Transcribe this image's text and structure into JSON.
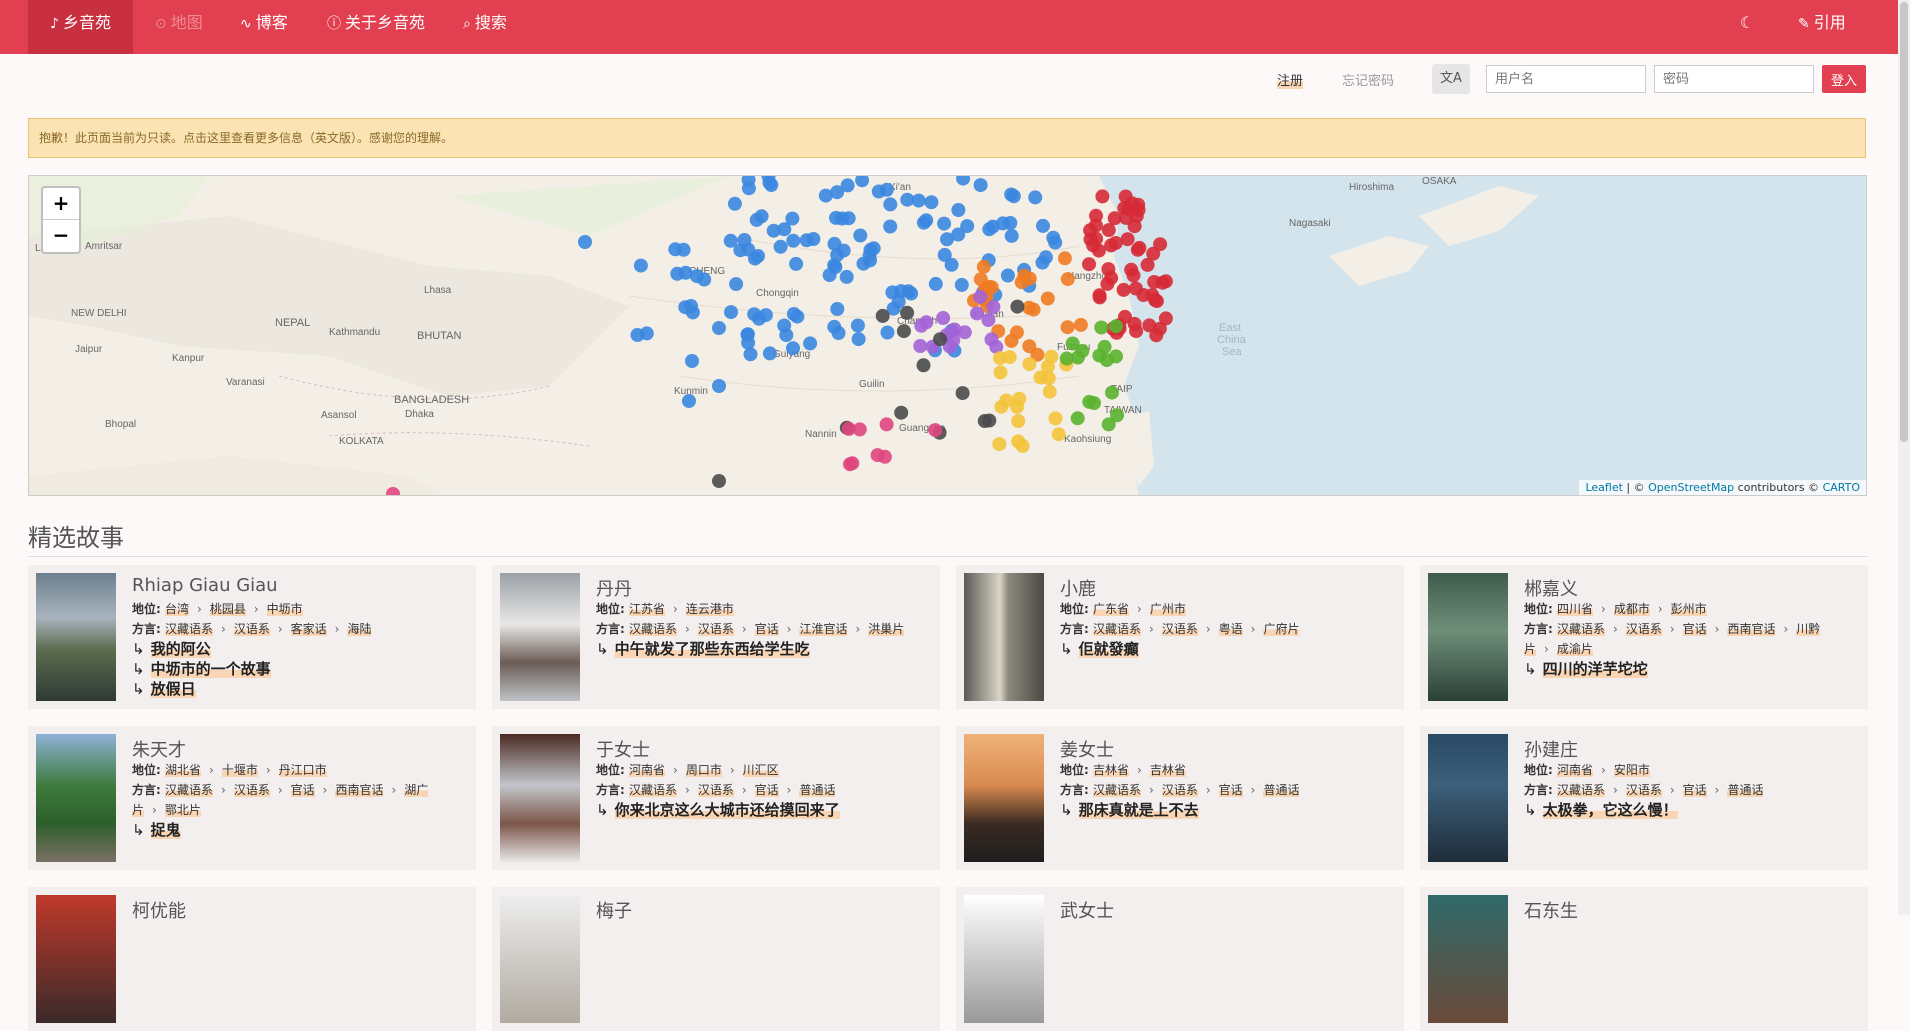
{
  "nav": {
    "brand": "乡音苑",
    "map": "地图",
    "blog": "博客",
    "about": "关于乡音苑",
    "search": "搜索",
    "cite": "引用"
  },
  "login": {
    "register": "注册",
    "forgot": "忘记密码",
    "username_placeholder": "用户名",
    "password_placeholder": "密码",
    "submit": "登入"
  },
  "alert": "抱歉！此页面当前为只读。点击这里查看更多信息（英文版）。感谢您的理解。",
  "map": {
    "labels": {
      "china_sea_1": "East",
      "china_sea_2": "China",
      "china_sea_3": "Sea",
      "osaka": "OSAKA",
      "hiroshima": "Hiroshima",
      "nagasaki": "Nagasaki",
      "lahore": "Lahore",
      "amritsar": "Amritsar",
      "new_delhi": "NEW DELHI",
      "nepal": "NEPAL",
      "kathmandu": "Kathmandu",
      "bhutan": "BHUTAN",
      "lhasa": "Lhasa",
      "jaipur": "Jaipur",
      "kanpur": "Kanpur",
      "varanasi": "Varanasi",
      "bangladesh": "BANGLADESH",
      "dhaka": "Dhaka",
      "asansol": "Asansol",
      "bhopal": "Bhopal",
      "kolkata": "KOLKATA",
      "chengdu": "CHENG",
      "xian": "Xi'an",
      "taipei": "TAIP",
      "taiwan": "TAIWAN",
      "kaohsiung": "Kaohsiung",
      "guilin": "Guilin",
      "kunming": "Kunmin",
      "guiyang": "Guiyang",
      "nanning": "Nannin",
      "guangzhou": "Guangzho",
      "hangzhou": "Hangzho",
      "nanchang": "anchan",
      "changsha": "Changsh",
      "fuzhou": "Fuzhou",
      "chongqing": "Chongqin"
    },
    "attribution": {
      "leaflet": "Leaflet",
      "sep": " | © ",
      "osm": "OpenStreetMap",
      "contrib": " contributors © ",
      "carto": "CARTO"
    },
    "marker_colors": [
      "#3b87e0",
      "#d62a36",
      "#f07b23",
      "#a463d6",
      "#f3c33a",
      "#5ab32f",
      "#4a4a4a",
      "#e0467f"
    ]
  },
  "section_title": "精选故事",
  "labels": {
    "place": "地位:",
    "dialect": "方言:",
    "arrow": "↳"
  },
  "stories": [
    {
      "name": "Rhiap Giau Giau",
      "place": [
        "台湾",
        "桃园县",
        "中坜市"
      ],
      "dialect": [
        "汉藏语系",
        "汉语系",
        "客家话",
        "海陆"
      ],
      "titles": [
        "我的阿公",
        "中坜市的一个故事",
        "放假日"
      ]
    },
    {
      "name": "丹丹",
      "place": [
        "江苏省",
        "连云港市"
      ],
      "dialect": [
        "汉藏语系",
        "汉语系",
        "官话",
        "江淮官话",
        "洪巢片"
      ],
      "titles": [
        "中午就发了那些东西给学生吃"
      ]
    },
    {
      "name": "小鹿",
      "place": [
        "广东省",
        "广州市"
      ],
      "dialect": [
        "汉藏语系",
        "汉语系",
        "粤语",
        "广府片"
      ],
      "titles": [
        "佢就發癲"
      ]
    },
    {
      "name": "郴嘉义",
      "place": [
        "四川省",
        "成都市",
        "彭州市"
      ],
      "dialect": [
        "汉藏语系",
        "汉语系",
        "官话",
        "西南官话",
        "川黔片",
        "成渝片"
      ],
      "titles": [
        "四川的洋芋坨坨"
      ]
    },
    {
      "name": "朱天才",
      "place": [
        "湖北省",
        "十堰市",
        "丹江口市"
      ],
      "dialect": [
        "汉藏语系",
        "汉语系",
        "官话",
        "西南官话",
        "湖广片",
        "鄂北片"
      ],
      "titles": [
        "捉鬼"
      ]
    },
    {
      "name": "于女士",
      "place": [
        "河南省",
        "周口市",
        "川汇区"
      ],
      "dialect": [
        "汉藏语系",
        "汉语系",
        "官话",
        "普通话"
      ],
      "titles": [
        "你来北京这么大城市还给摸回来了"
      ]
    },
    {
      "name": "姜女士",
      "place": [
        "吉林省",
        "吉林省"
      ],
      "dialect": [
        "汉藏语系",
        "汉语系",
        "官话",
        "普通话"
      ],
      "titles": [
        "那床真就是上不去"
      ]
    },
    {
      "name": "孙建庄",
      "place": [
        "河南省",
        "安阳市"
      ],
      "dialect": [
        "汉藏语系",
        "汉语系",
        "官话",
        "普通话"
      ],
      "titles": [
        "太极拳，它这么慢！"
      ]
    },
    {
      "name": "柯优能"
    },
    {
      "name": "梅子"
    },
    {
      "name": "武女士"
    },
    {
      "name": "石东生"
    }
  ]
}
